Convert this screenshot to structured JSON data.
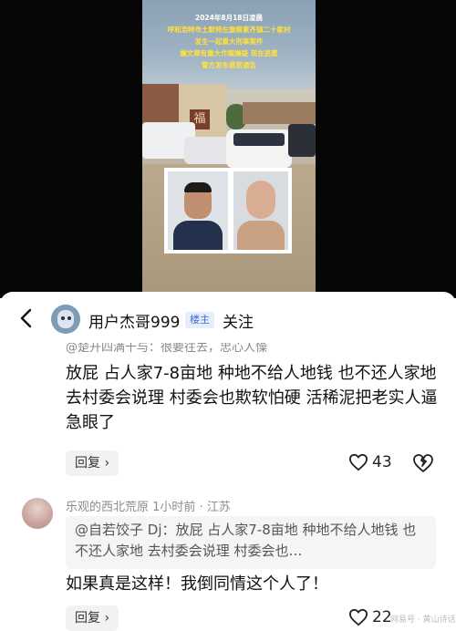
{
  "video": {
    "caption_lines": [
      "2024年8月18日凌晨",
      "呼和浩特市土默特左旗察素齐镇二十家村",
      "发生一起重大刑事案件",
      "嫌文章有重大作案嫌疑 现在逃匿",
      "警方发布悬赏通告"
    ],
    "sign_char": "福"
  },
  "thread": {
    "back_icon": "chevron-left-icon",
    "author_name": "用户杰哥999",
    "op_badge": "楼主",
    "follow_label": "关注",
    "partial_text": "@楚开四满十与：很要往去，忠心人懆",
    "main_comment": "放屁 占人家7-8亩地 种地不给人地钱 也不还人家地 去村委会说理 村委会也欺软怕硬 活稀泥把老实人逼急眼了",
    "reply_label": "回复 ›",
    "like_count": "43"
  },
  "reply": {
    "author": "乐观的西北荒原",
    "meta_separator": "·",
    "time": "1小时前",
    "location": "江苏",
    "quote": "@自若饺子 Dj：放屁 占人家7-8亩地 种地不给人地钱 也不还人家地 去村委会说理 村委会也…",
    "text": "如果真是这样！我倒同情这个人了！",
    "reply_label": "回复 ›",
    "like_count": "22"
  },
  "watermark": "网易号 · 黄山诗话",
  "colors": {
    "caption": "#ffe23b",
    "badge_text": "#3d6dd8",
    "badge_bg": "#e6eefc"
  }
}
